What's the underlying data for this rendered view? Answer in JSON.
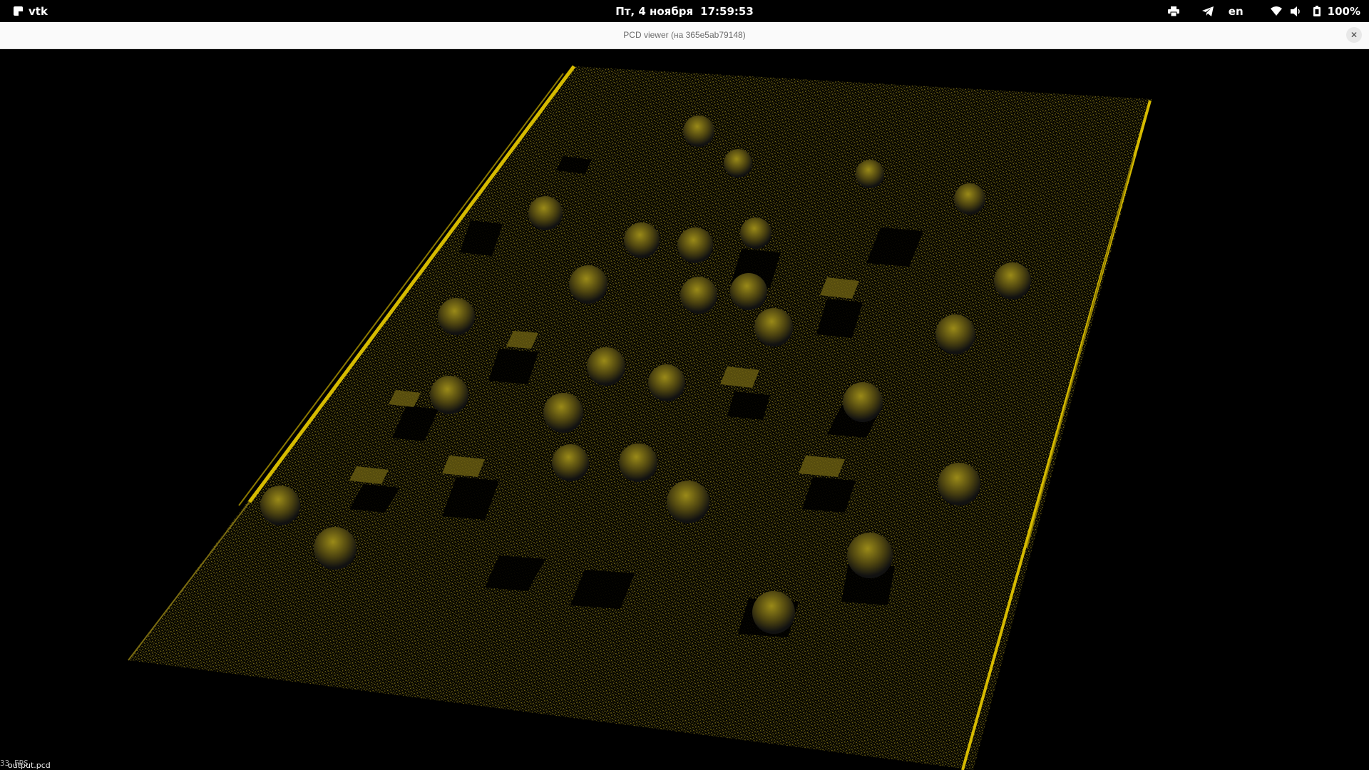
{
  "top_panel": {
    "app_name": "vtk",
    "date": "Пт, 4 ноября",
    "time": "17:59:53",
    "language": "en",
    "battery": "100%",
    "icons": [
      "printer-icon",
      "telegram-icon",
      "wifi-icon",
      "volume-icon",
      "battery-icon"
    ]
  },
  "window": {
    "title": "PCD viewer (на 365e5ab79148)",
    "close_glyph": "✕"
  },
  "viewport": {
    "background": "#000000",
    "point_color": "#c8b000",
    "cloud_label": "output.pcd",
    "fps_text": "33 FPS"
  }
}
